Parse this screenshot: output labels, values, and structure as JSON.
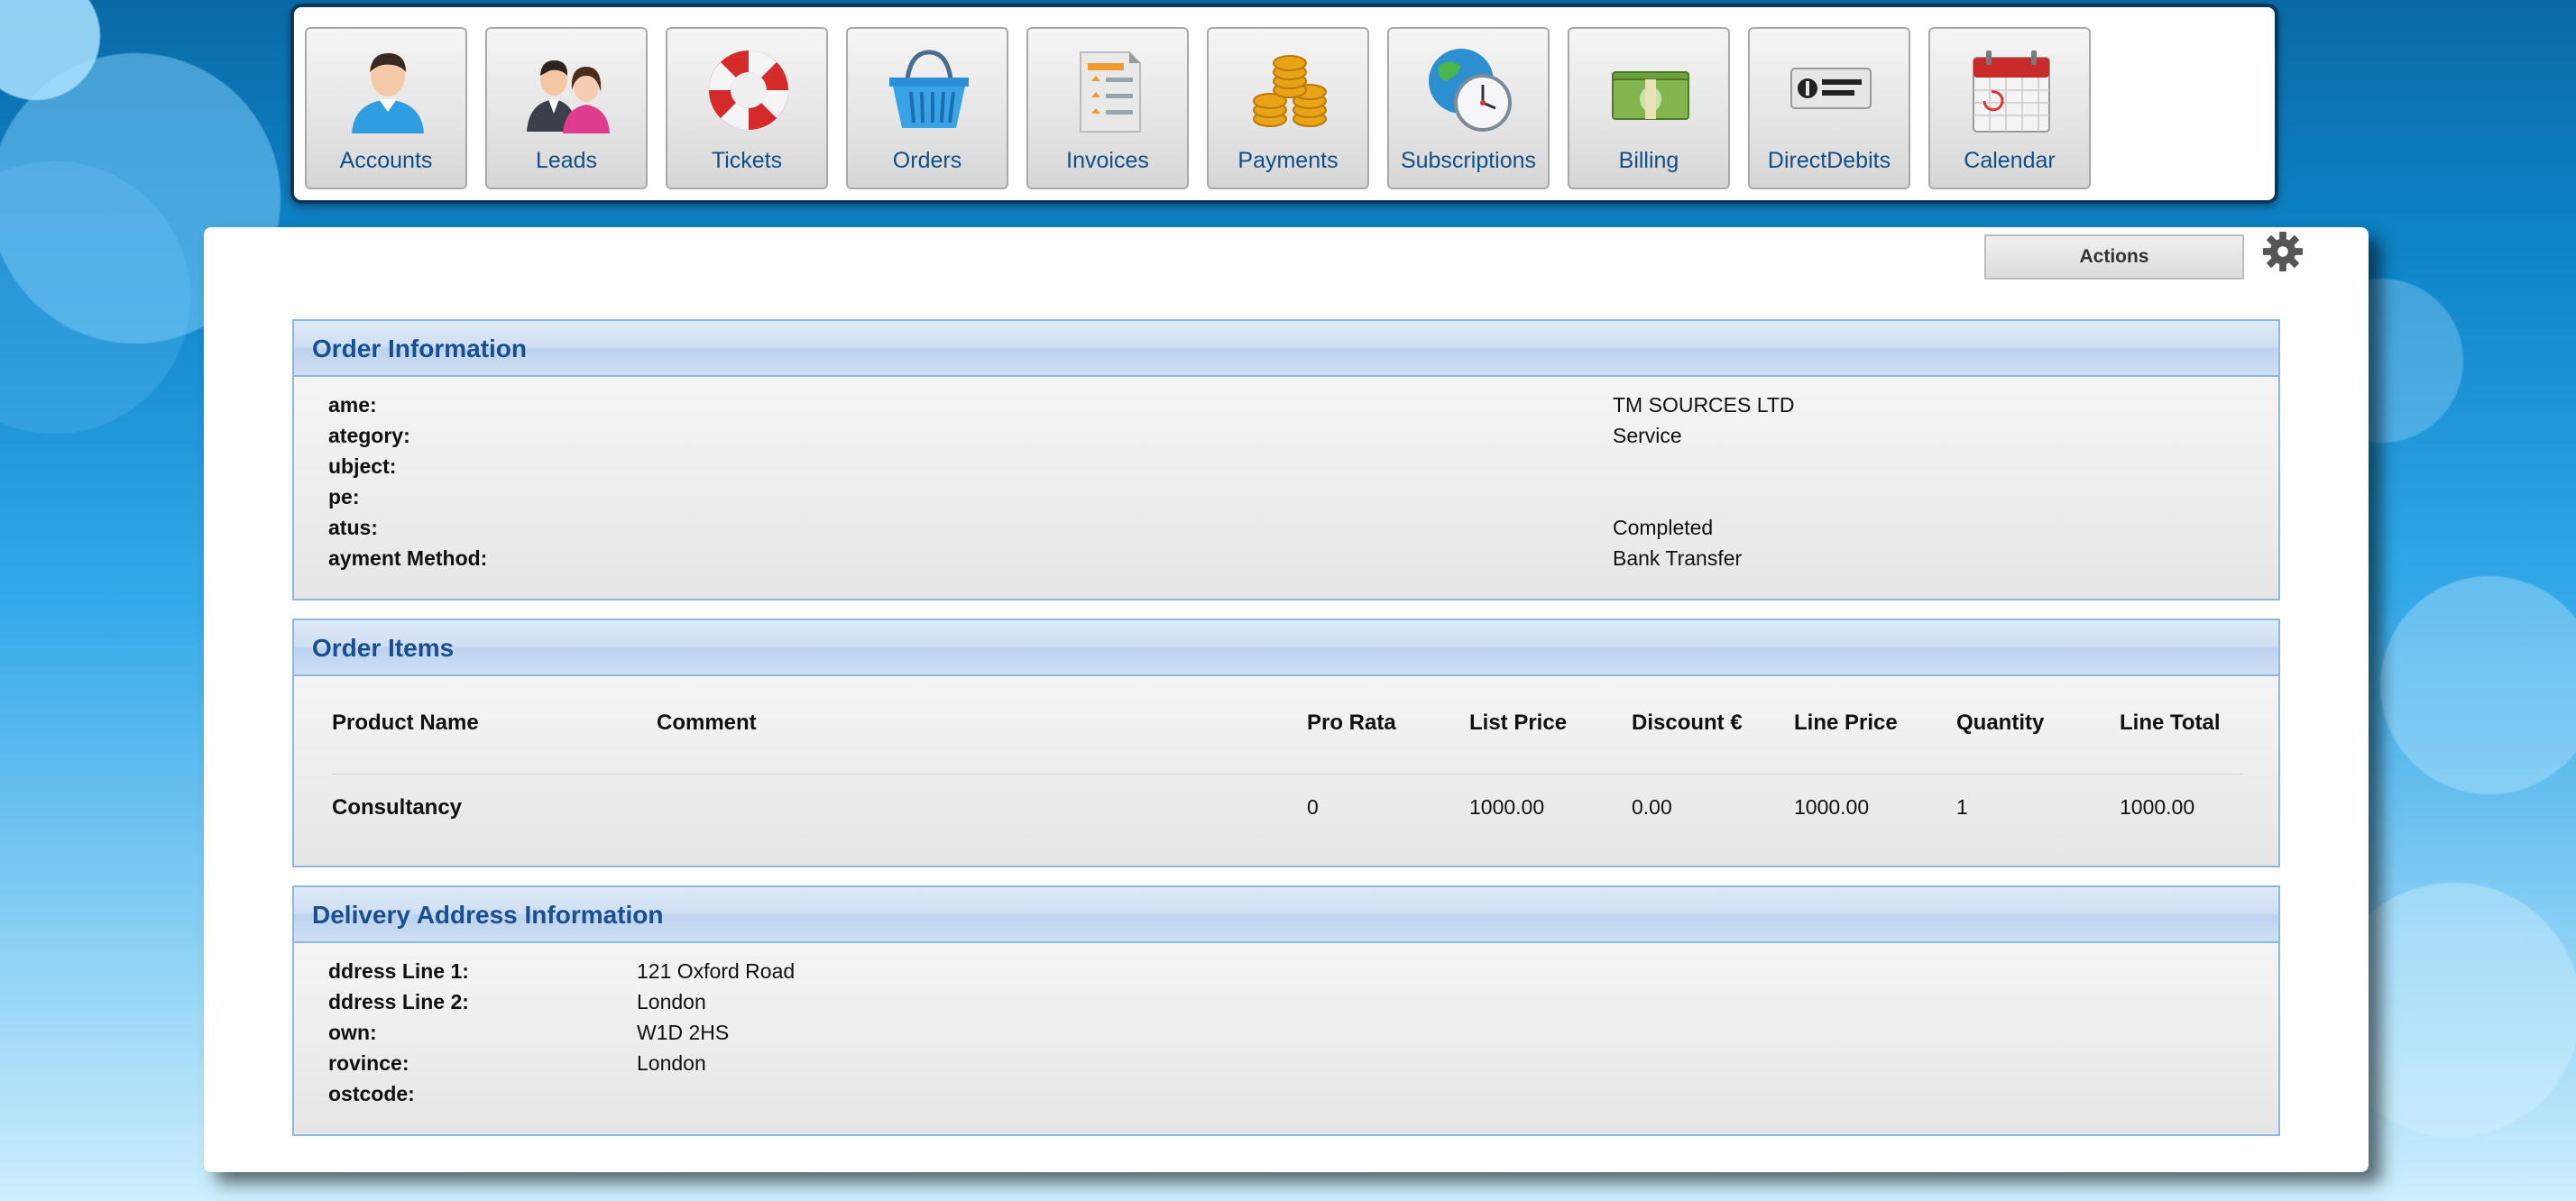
{
  "nav": [
    {
      "label": "Accounts",
      "icon": "accounts-icon"
    },
    {
      "label": "Leads",
      "icon": "leads-icon"
    },
    {
      "label": "Tickets",
      "icon": "lifebuoy-icon"
    },
    {
      "label": "Orders",
      "icon": "basket-icon"
    },
    {
      "label": "Invoices",
      "icon": "invoice-icon"
    },
    {
      "label": "Payments",
      "icon": "coins-icon"
    },
    {
      "label": "Subscriptions",
      "icon": "globe-clock-icon"
    },
    {
      "label": "Billing",
      "icon": "banknotes-icon"
    },
    {
      "label": "DirectDebits",
      "icon": "direct-debit-icon"
    },
    {
      "label": "Calendar",
      "icon": "calendar-icon"
    }
  ],
  "toolbar": {
    "actions_label": "Actions",
    "gear_icon": "gear-icon"
  },
  "order_info": {
    "title": "Order Information",
    "fields": [
      {
        "label": "ame:",
        "value": "TM SOURCES LTD"
      },
      {
        "label": "ategory:",
        "value": "Service"
      },
      {
        "label": "ubject:",
        "value": ""
      },
      {
        "label": "pe:",
        "value": ""
      },
      {
        "label": "atus:",
        "value": "Completed"
      },
      {
        "label": "ayment Method:",
        "value": "Bank Transfer"
      }
    ]
  },
  "order_items": {
    "title": "Order Items",
    "columns": [
      "Product Name",
      "Comment",
      "Pro Rata",
      "List Price",
      "Discount €",
      "Line Price",
      "Quantity",
      "Line Total"
    ],
    "rows": [
      [
        "Consultancy",
        "",
        "0",
        "1000.00",
        "0.00",
        "1000.00",
        "1",
        "1000.00"
      ]
    ]
  },
  "delivery": {
    "title": "Delivery Address Information",
    "fields": [
      {
        "label": "ddress Line 1:",
        "value": "121 Oxford Road"
      },
      {
        "label": "ddress Line 2:",
        "value": "London"
      },
      {
        "label": "own:",
        "value": "W1D 2HS"
      },
      {
        "label": "rovince:",
        "value": "London"
      },
      {
        "label": "ostcode:",
        "value": ""
      }
    ]
  },
  "colors": {
    "heading": "#184f8f",
    "nav_label": "#134f87",
    "section_border": "#8db8e0"
  }
}
